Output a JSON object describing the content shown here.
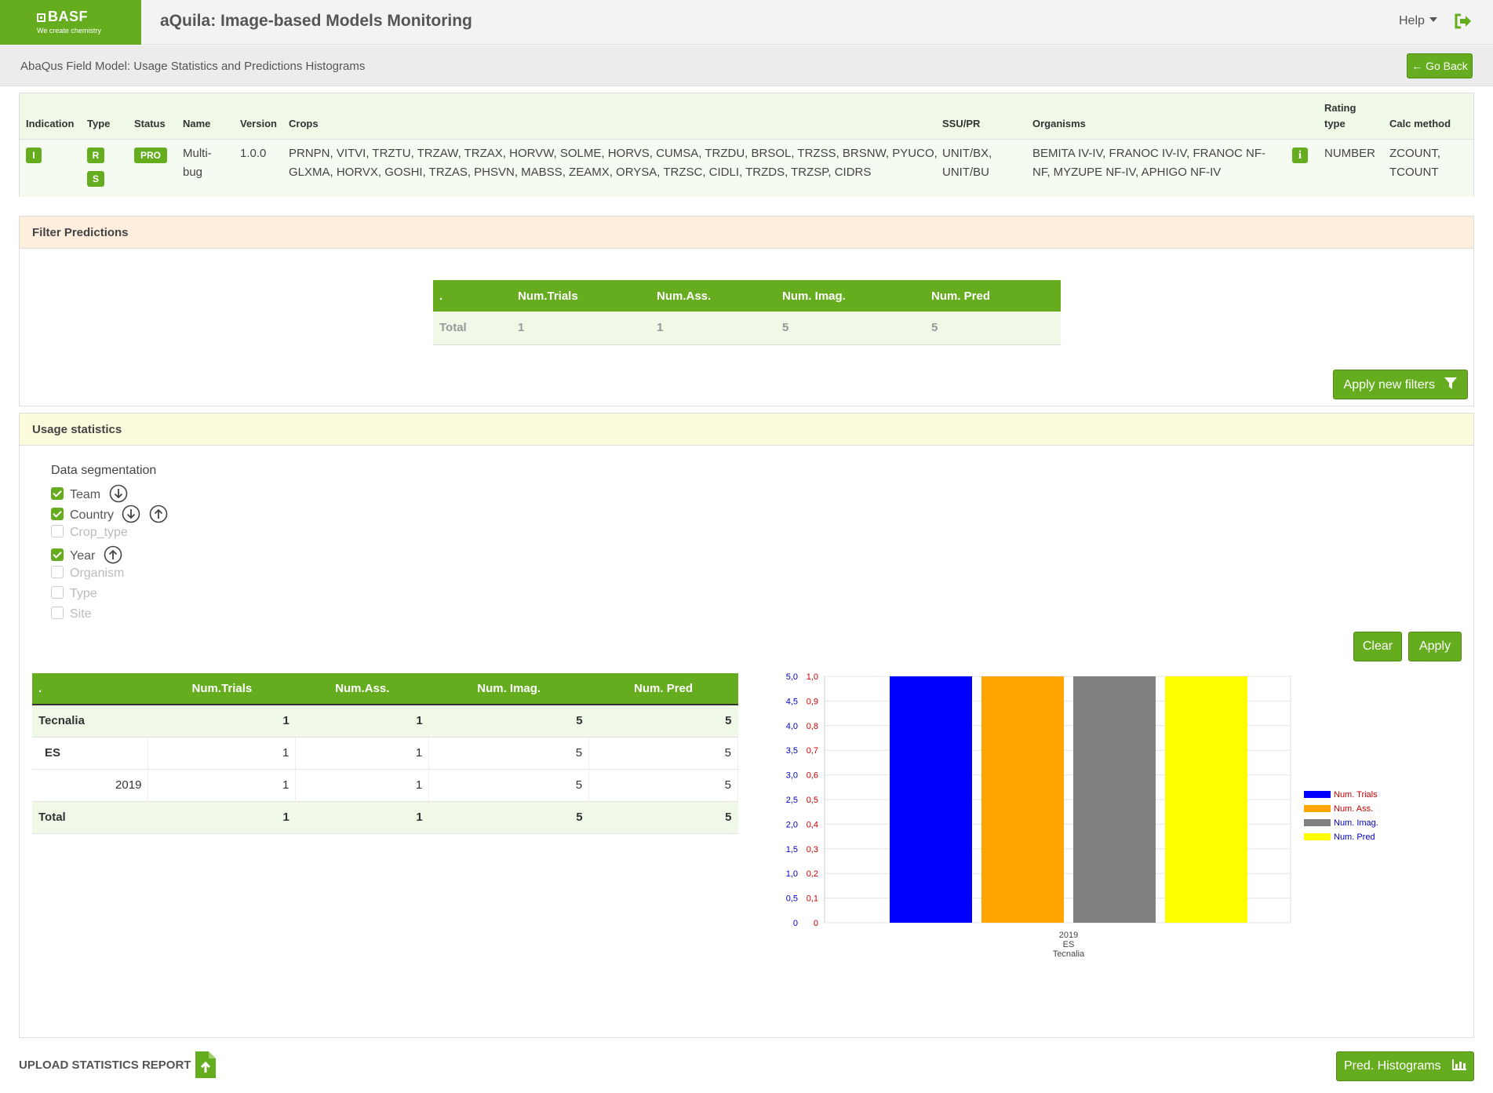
{
  "app": {
    "brand": "BASF",
    "tagline": "We create chemistry",
    "title": "aQuila: Image-based Models Monitoring",
    "help_label": "Help"
  },
  "subbar": {
    "title": "AbaQus Field Model: Usage Statistics and Predictions Histograms",
    "go_back_label": "Go Back"
  },
  "model_info": {
    "headers": {
      "indication": "Indication",
      "type": "Type",
      "status": "Status",
      "name": "Name",
      "version": "Version",
      "crops": "Crops",
      "ssu_pr": "SSU/PR",
      "organisms": "Organisms",
      "rating_type_1": "Rating",
      "rating_type_2": "type",
      "calc_method": "Calc method"
    },
    "row": {
      "indication": "I",
      "type_1": "R",
      "type_2": "S",
      "status": "PRO",
      "name_1": "Multi-",
      "name_2": "bug",
      "version": "1.0.0",
      "crops_1": "PRNPN, VITVI, TRZTU, TRZAW, TRZAX, HORVW, SOLME, HORVS, CUMSA, TRZDU, BRSOL, TRZSS, BRSNW, PYUCO,",
      "crops_2": "GLXMA, HORVX, GOSHI, TRZAS, PHSVN, MABSS, ZEAMX, ORYSA, TRZSC, CIDLI, TRZDS, TRZSP, CIDRS",
      "ssu_pr_1": "UNIT/BX,",
      "ssu_pr_2": "UNIT/BU",
      "organisms_1": "BEMITA IV-IV, FRANOC IV-IV, FRANOC NF-",
      "organisms_2": "NF, MYZUPE NF-IV, APHIGO NF-IV",
      "info_badge": "i",
      "rating_type": "NUMBER",
      "calc_method_1": "ZCOUNT,",
      "calc_method_2": "TCOUNT"
    }
  },
  "filter_predictions": {
    "title": "Filter Predictions",
    "table_headers": [
      ".",
      "Num.Trials",
      "Num.Ass.",
      "Num. Imag.",
      "Num. Pred"
    ],
    "total_row": [
      "Total",
      "1",
      "1",
      "5",
      "5"
    ],
    "apply_label": "Apply new filters"
  },
  "usage_statistics": {
    "title": "Usage statistics",
    "segmentation_title": "Data segmentation",
    "segments": [
      {
        "label": "Team",
        "checked": true
      },
      {
        "label": "Country",
        "checked": true
      },
      {
        "label": "Crop_type",
        "checked": false
      },
      {
        "label": "Year",
        "checked": true
      },
      {
        "label": "Organism",
        "checked": false
      },
      {
        "label": "Type",
        "checked": false
      },
      {
        "label": "Site",
        "checked": false
      }
    ],
    "clear_label": "Clear",
    "apply_label": "Apply",
    "table_headers": [
      ".",
      "Num.Trials",
      "Num.Ass.",
      "Num. Imag.",
      "Num. Pred"
    ],
    "rows": [
      {
        "label": "Tecnalia",
        "values": [
          "1",
          "1",
          "5",
          "5"
        ]
      },
      {
        "label": "ES",
        "values": [
          "1",
          "1",
          "5",
          "5"
        ]
      },
      {
        "label": "2019",
        "values": [
          "1",
          "1",
          "5",
          "5"
        ]
      },
      {
        "label": "Total",
        "values": [
          "1",
          "1",
          "5",
          "5"
        ]
      }
    ]
  },
  "chart_data": {
    "type": "bar",
    "categories": [
      "2019 / ES / Tecnalia"
    ],
    "category_label_lines": [
      "2019",
      "ES",
      "Tecnalia"
    ],
    "series": [
      {
        "name": "Num. Trials",
        "values": [
          1
        ],
        "color": "#0000ff",
        "axis": "right"
      },
      {
        "name": "Num. Ass.",
        "values": [
          1
        ],
        "color": "#ffa500",
        "axis": "right"
      },
      {
        "name": "Num. Imag.",
        "values": [
          5
        ],
        "color": "#808080",
        "axis": "left"
      },
      {
        "name": "Num. Pred",
        "values": [
          5
        ],
        "color": "#ffff00",
        "axis": "left"
      }
    ],
    "left_axis": {
      "ticks": [
        "0",
        "0,5",
        "1,0",
        "1,5",
        "2,0",
        "2,5",
        "3,0",
        "3,5",
        "4,0",
        "4,5",
        "5,0"
      ],
      "range": [
        0,
        5
      ],
      "color": "#0000cc"
    },
    "right_axis": {
      "ticks": [
        "0",
        "0,1",
        "0,2",
        "0,3",
        "0,4",
        "0,5",
        "0,6",
        "0,7",
        "0,8",
        "0,9",
        "1,0"
      ],
      "range": [
        0,
        1
      ],
      "color": "#cc0000"
    },
    "legend_position": "right",
    "grid": true
  },
  "footer": {
    "upload_label": "UPLOAD STATISTICS REPORT",
    "pred_histograms_label": "Pred. Histograms"
  }
}
